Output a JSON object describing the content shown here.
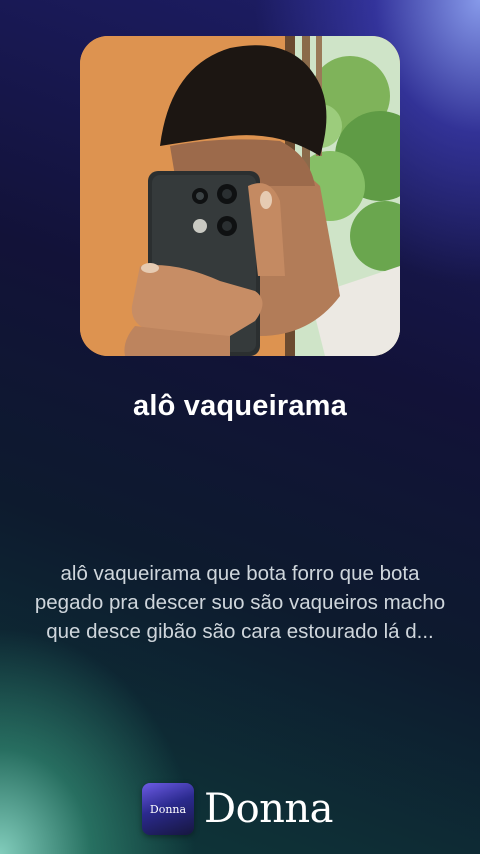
{
  "track": {
    "title": "alô vaqueirama",
    "description": "alô vaqueirama que bota forro que bota pegado pra descer suo são vaqueiros macho que desce gibão são cara estourado lá d..."
  },
  "brand": {
    "icon_text": "Donna",
    "name": "Donna"
  },
  "colors": {
    "background_top": "#1e1e6a",
    "background_bottom": "#0e3a3a",
    "accent_purple": "#6d5ce6",
    "accent_teal": "#96e6d2"
  }
}
